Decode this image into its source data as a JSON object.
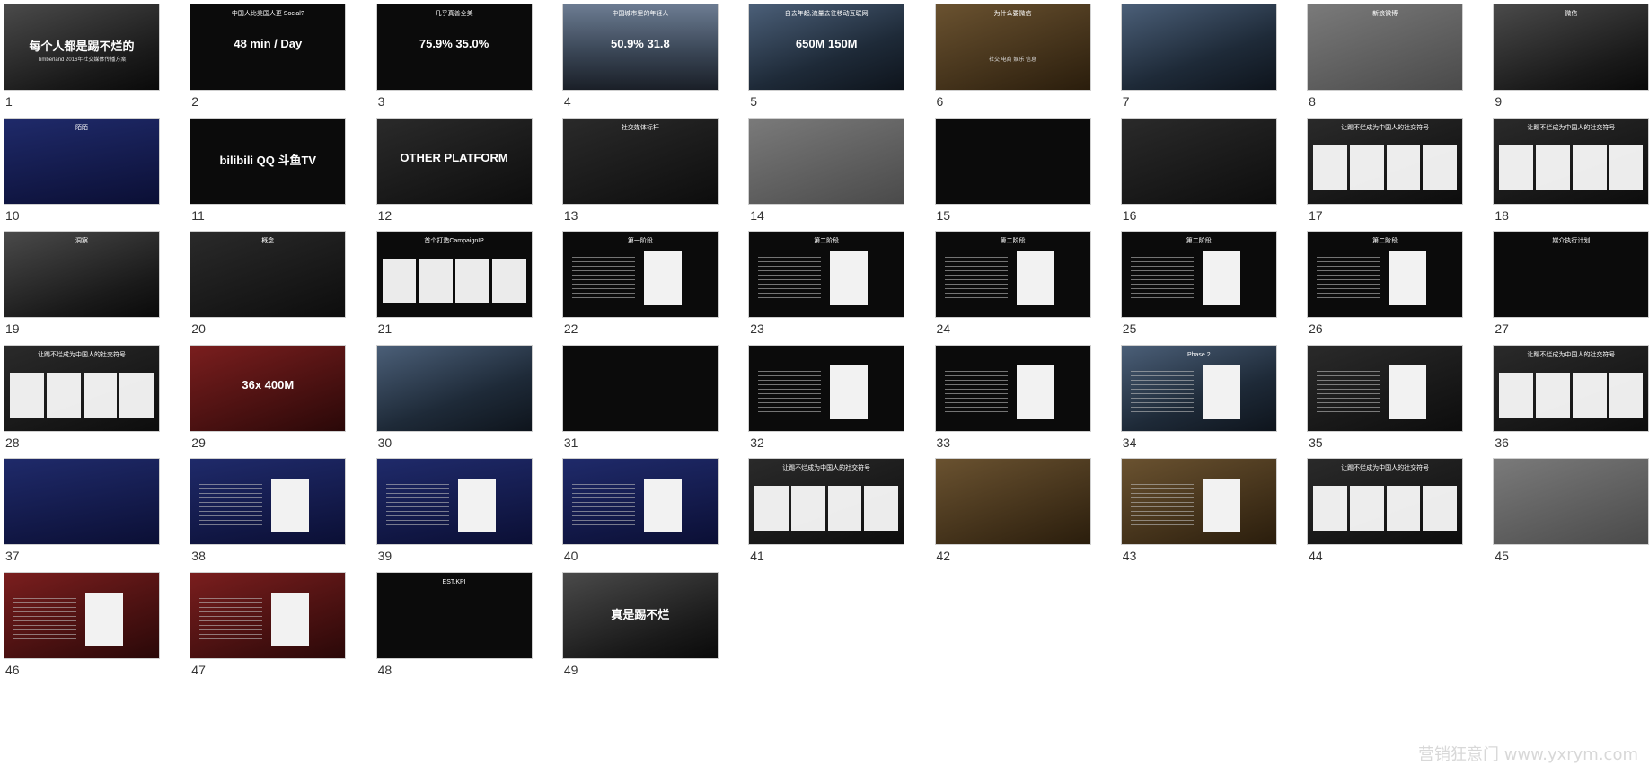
{
  "watermark": "营销狂意门 www.yxrym.com",
  "slides": [
    {
      "number": "1",
      "style": "photo",
      "title": "",
      "big": "每个人都是踢不烂的",
      "sub": "Timberland 2016年社交媒体传播方案"
    },
    {
      "number": "2",
      "style": "black",
      "title": "中国人比美国人更 Social?",
      "big": "48 min / Day",
      "sub": ""
    },
    {
      "number": "3",
      "style": "black",
      "title": "几乎真善全美",
      "big": "75.9%  35.0%",
      "sub": ""
    },
    {
      "number": "4",
      "style": "city",
      "title": "中国城市里的年轻人",
      "big": "50.9%   31.8",
      "sub": ""
    },
    {
      "number": "5",
      "style": "blue",
      "title": "自去年起,流量去往移动互联网",
      "big": "650M  150M",
      "sub": ""
    },
    {
      "number": "6",
      "style": "warm",
      "title": "为什么要微信",
      "big": "",
      "sub": "社交  电商  娱乐  信息"
    },
    {
      "number": "7",
      "style": "blue",
      "title": "",
      "big": "",
      "sub": ""
    },
    {
      "number": "8",
      "style": "grey",
      "title": "新浪微博",
      "big": "",
      "sub": ""
    },
    {
      "number": "9",
      "style": "photo",
      "title": "微信",
      "big": "",
      "sub": ""
    },
    {
      "number": "10",
      "style": "navy",
      "title": "陌陌",
      "big": "",
      "sub": ""
    },
    {
      "number": "11",
      "style": "black",
      "title": "",
      "big": "bilibili  QQ  斗鱼TV",
      "sub": ""
    },
    {
      "number": "12",
      "style": "dark",
      "title": "",
      "big": "OTHER PLATFORM",
      "sub": ""
    },
    {
      "number": "13",
      "style": "dark",
      "title": "社交媒体标杆",
      "big": "",
      "sub": ""
    },
    {
      "number": "14",
      "style": "grey",
      "title": "",
      "big": "",
      "sub": ""
    },
    {
      "number": "15",
      "style": "black",
      "title": "",
      "big": "",
      "sub": ""
    },
    {
      "number": "16",
      "style": "dark",
      "title": "",
      "big": "",
      "sub": ""
    },
    {
      "number": "17",
      "style": "dark",
      "title": "让踢不烂成为中国人的社交符号",
      "big": "",
      "sub": "",
      "cols": true
    },
    {
      "number": "18",
      "style": "dark",
      "title": "让踢不烂成为中国人的社交符号",
      "big": "",
      "sub": "",
      "cols": true
    },
    {
      "number": "19",
      "style": "photo",
      "title": "洞察",
      "big": "",
      "sub": ""
    },
    {
      "number": "20",
      "style": "dark",
      "title": "概念",
      "big": "",
      "sub": ""
    },
    {
      "number": "21",
      "style": "black",
      "title": "首个打造CampaignIP",
      "big": "",
      "sub": "",
      "cols": true
    },
    {
      "number": "22",
      "style": "black",
      "title": "第一阶段",
      "big": "",
      "sub": "",
      "panel": true
    },
    {
      "number": "23",
      "style": "black",
      "title": "第二阶段",
      "big": "",
      "sub": "",
      "panel": true
    },
    {
      "number": "24",
      "style": "black",
      "title": "第二阶段",
      "big": "",
      "sub": "",
      "panel": true
    },
    {
      "number": "25",
      "style": "black",
      "title": "第二阶段",
      "big": "",
      "sub": "",
      "panel": true
    },
    {
      "number": "26",
      "style": "black",
      "title": "第二阶段",
      "big": "",
      "sub": "",
      "panel": true
    },
    {
      "number": "27",
      "style": "black",
      "title": "媒介执行计划",
      "big": "",
      "sub": ""
    },
    {
      "number": "28",
      "style": "dark",
      "title": "让踢不烂成为中国人的社交符号",
      "big": "",
      "sub": "",
      "cols": true
    },
    {
      "number": "29",
      "style": "red",
      "title": "",
      "big": "36x   400M",
      "sub": ""
    },
    {
      "number": "30",
      "style": "blue",
      "title": "",
      "big": "",
      "sub": ""
    },
    {
      "number": "31",
      "style": "black",
      "title": "",
      "big": "",
      "sub": ""
    },
    {
      "number": "32",
      "style": "black",
      "title": "",
      "big": "",
      "sub": "",
      "panel": true
    },
    {
      "number": "33",
      "style": "black",
      "title": "",
      "big": "",
      "sub": "",
      "panel": true
    },
    {
      "number": "34",
      "style": "blue",
      "title": "Phase 2",
      "big": "",
      "sub": "",
      "panel": true
    },
    {
      "number": "35",
      "style": "dark",
      "title": "",
      "big": "",
      "sub": "",
      "panel": true
    },
    {
      "number": "36",
      "style": "dark",
      "title": "让踢不烂成为中国人的社交符号",
      "big": "",
      "sub": "",
      "cols": true
    },
    {
      "number": "37",
      "style": "navy",
      "title": "",
      "big": "",
      "sub": ""
    },
    {
      "number": "38",
      "style": "navy",
      "title": "",
      "big": "",
      "sub": "",
      "panel": true
    },
    {
      "number": "39",
      "style": "navy",
      "title": "",
      "big": "",
      "sub": "",
      "panel": true
    },
    {
      "number": "40",
      "style": "navy",
      "title": "",
      "big": "",
      "sub": "",
      "panel": true
    },
    {
      "number": "41",
      "style": "dark",
      "title": "让踢不烂成为中国人的社交符号",
      "big": "",
      "sub": "",
      "cols": true
    },
    {
      "number": "42",
      "style": "warm",
      "title": "",
      "big": "",
      "sub": ""
    },
    {
      "number": "43",
      "style": "warm",
      "title": "",
      "big": "",
      "sub": "",
      "panel": true
    },
    {
      "number": "44",
      "style": "dark",
      "title": "让踢不烂成为中国人的社交符号",
      "big": "",
      "sub": "",
      "cols": true
    },
    {
      "number": "45",
      "style": "grey",
      "title": "",
      "big": "",
      "sub": ""
    },
    {
      "number": "46",
      "style": "red",
      "title": "",
      "big": "",
      "sub": "",
      "panel": true
    },
    {
      "number": "47",
      "style": "red",
      "title": "",
      "big": "",
      "sub": "",
      "panel": true
    },
    {
      "number": "48",
      "style": "black",
      "title": "EST.KPI",
      "big": "",
      "sub": ""
    },
    {
      "number": "49",
      "style": "photo",
      "title": "",
      "big": "真是踢不烂",
      "sub": ""
    }
  ]
}
